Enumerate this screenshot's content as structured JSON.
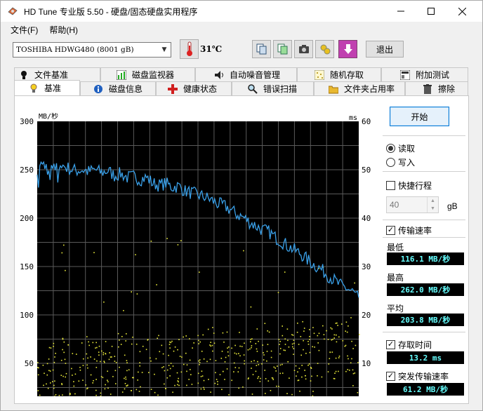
{
  "window": {
    "title": "HD Tune 专业版 5.50 - 硬盘/固态硬盘实用程序"
  },
  "menu": [
    "文件(F)",
    "帮助(H)"
  ],
  "toolbar": {
    "drive": "TOSHIBA HDWG480 (8001 gB)",
    "temperature": "31℃",
    "exit_label": "退出"
  },
  "tabs_row1": [
    {
      "label": "文件基准",
      "icon": "file-benchmark-icon"
    },
    {
      "label": "磁盘监视器",
      "icon": "disk-monitor-icon"
    },
    {
      "label": "自动噪音管理",
      "icon": "speaker-icon"
    },
    {
      "label": "随机存取",
      "icon": "random-access-icon"
    },
    {
      "label": "附加测试",
      "icon": "extra-tests-icon"
    }
  ],
  "tabs_row2": [
    {
      "label": "基准",
      "icon": "lightbulb-icon",
      "active": true
    },
    {
      "label": "磁盘信息",
      "icon": "info-icon"
    },
    {
      "label": "健康状态",
      "icon": "health-cross-icon"
    },
    {
      "label": "错误扫描",
      "icon": "magnifier-icon"
    },
    {
      "label": "文件夹占用率",
      "icon": "folder-icon"
    },
    {
      "label": "擦除",
      "icon": "trash-icon"
    }
  ],
  "controls": {
    "start_label": "开始",
    "read_label": "读取",
    "write_label": "写入",
    "read_selected": true,
    "quick_label": "快捷行程",
    "quick_checked": false,
    "quick_value": "40",
    "quick_unit": "gB",
    "transfer_label": "传输速率",
    "transfer_checked": true,
    "min_label": "最低",
    "min_value": "116.1 MB/秒",
    "max_label": "最高",
    "max_value": "262.0 MB/秒",
    "avg_label": "平均",
    "avg_value": "203.8 MB/秒",
    "access_label": "存取时间",
    "access_checked": true,
    "access_value": "13.2 ms",
    "burst_label": "突发传输速率",
    "burst_checked": true,
    "burst_value": "61.2 MB/秒"
  },
  "chart_data": {
    "type": "line",
    "left_unit": "MB/秒",
    "right_unit": "ms",
    "left_ylim": [
      0,
      300
    ],
    "right_ylim": [
      0,
      60
    ],
    "left_ticks": [
      "300",
      "250",
      "200",
      "150",
      "100",
      "50"
    ],
    "right_ticks": [
      "60",
      "50",
      "40",
      "30",
      "20",
      "10"
    ],
    "grid": true,
    "colors": {
      "transfer": "#3aa0e8",
      "access": "#e8e83a",
      "background": "#000000",
      "grid": "#5a5a5a"
    },
    "series": [
      {
        "name": "传输速率",
        "x": [
          0,
          2,
          4,
          6,
          8,
          10,
          12,
          14,
          16,
          18,
          20,
          22,
          24,
          26,
          28,
          30,
          32,
          34,
          36,
          38,
          40,
          42,
          44,
          46,
          48,
          50,
          52,
          54,
          56,
          58,
          60,
          62,
          64,
          66,
          68,
          70,
          72,
          74,
          76,
          78,
          80,
          82,
          84,
          86,
          88,
          90,
          92,
          94,
          96,
          98,
          100
        ],
        "y": [
          252,
          256,
          248,
          252,
          254,
          251,
          249,
          250,
          248,
          250,
          247,
          249,
          244,
          246,
          242,
          243,
          240,
          242,
          236,
          234,
          236,
          232,
          233,
          228,
          226,
          224,
          222,
          219,
          215,
          213,
          209,
          204,
          201,
          196,
          192,
          188,
          186,
          180,
          176,
          171,
          167,
          163,
          157,
          152,
          148,
          142,
          137,
          131,
          128,
          124,
          118
        ]
      }
    ],
    "access_time_ms": {
      "center": 13.2,
      "spread": "scatter cloud roughly 5–20 ms"
    }
  }
}
